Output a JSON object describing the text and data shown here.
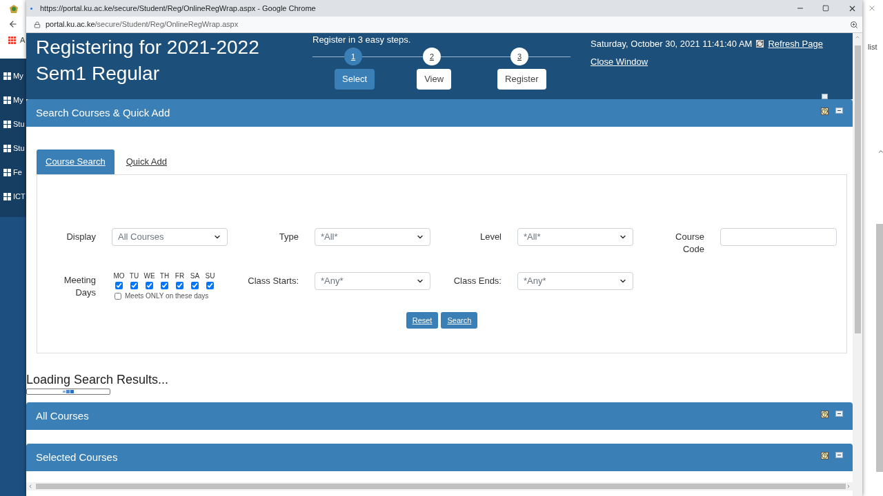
{
  "background_browser": {
    "bookmark_fragment": "A",
    "sidebar_items": [
      "My",
      "My",
      "Stu",
      "Stu",
      "Fe",
      "ICT"
    ],
    "right_fragment": "list"
  },
  "window": {
    "title": "https://portal.ku.ac.ke/secure/Student/Reg/OnlineRegWrap.aspx - Google Chrome",
    "url_host": "portal.ku.ac.ke",
    "url_path": "/secure/Student/Reg/OnlineRegWrap.aspx"
  },
  "header": {
    "title_lines": [
      "Registering for 2021-2022",
      "Sem1 Regular"
    ],
    "steps_caption": "Register in 3 easy steps.",
    "steps": [
      {
        "number": "1",
        "label": "Select",
        "selected": true
      },
      {
        "number": "2",
        "label": "View",
        "selected": false
      },
      {
        "number": "3",
        "label": "Register",
        "selected": false
      }
    ],
    "datetime": "Saturday, October 30, 2021 11:41:40 AM",
    "refresh_link": "Refresh Page",
    "close_link": "Close Window"
  },
  "search_panel": {
    "title": "Search Courses & Quick Add",
    "tabs": [
      {
        "label": "Course Search",
        "selected": true
      },
      {
        "label": "Quick Add",
        "selected": false
      }
    ],
    "display": {
      "label": "Display",
      "value": "All Courses"
    },
    "type": {
      "label": "Type",
      "value": "*All*"
    },
    "level": {
      "label": "Level",
      "value": "*All*"
    },
    "course_code": {
      "label": "Course Code"
    },
    "meeting_days": {
      "label": "Meeting Days",
      "days": [
        {
          "label": "MO",
          "checked": true
        },
        {
          "label": "TU",
          "checked": true
        },
        {
          "label": "WE",
          "checked": true
        },
        {
          "label": "TH",
          "checked": true
        },
        {
          "label": "FR",
          "checked": true
        },
        {
          "label": "SA",
          "checked": true
        },
        {
          "label": "SU",
          "checked": true
        }
      ],
      "only_option": {
        "label": "Meets ONLY on these days",
        "checked": false
      }
    },
    "class_starts": {
      "label": "Class Starts:",
      "value": "*Any*"
    },
    "class_ends": {
      "label": "Class Ends:",
      "value": "*Any*"
    },
    "buttons": [
      "Reset",
      "Search"
    ]
  },
  "loading": {
    "text": "Loading Search Results..."
  },
  "panels": [
    {
      "title": "All Courses"
    },
    {
      "title": "Selected Courses"
    }
  ]
}
